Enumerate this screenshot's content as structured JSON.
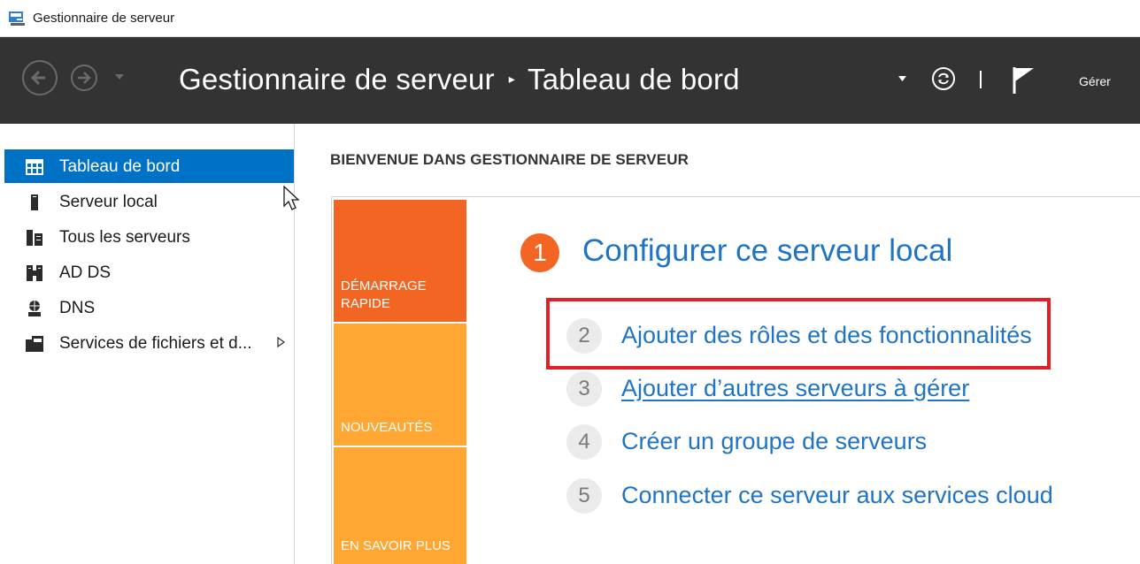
{
  "window": {
    "title": "Gestionnaire de serveur"
  },
  "header": {
    "breadcrumb_root": "Gestionnaire de serveur",
    "breadcrumb_separator": "▸",
    "breadcrumb_current": "Tableau de bord",
    "manage_label": "Gérer"
  },
  "sidebar": {
    "items": [
      {
        "label": "Tableau de bord",
        "icon": "dashboard-icon",
        "selected": true
      },
      {
        "label": "Serveur local",
        "icon": "server-icon"
      },
      {
        "label": "Tous les serveurs",
        "icon": "servers-icon"
      },
      {
        "label": "AD DS",
        "icon": "ad-ds-icon"
      },
      {
        "label": "DNS",
        "icon": "dns-icon"
      },
      {
        "label": "Services de fichiers et d...",
        "icon": "file-services-icon",
        "expandable": true
      }
    ]
  },
  "main": {
    "welcome_heading": "BIENVENUE DANS GESTIONNAIRE DE SERVEUR",
    "tiles": [
      {
        "label": "DÉMARRAGE RAPIDE",
        "color": "#f26522"
      },
      {
        "label": "NOUVEAUTÉS",
        "color": "#ffa633"
      },
      {
        "label": "EN SAVOIR PLUS",
        "color": "#ffa633"
      }
    ],
    "steps": [
      {
        "number": "1",
        "label": "Configurer ce serveur local"
      },
      {
        "number": "2",
        "label": "Ajouter des rôles et des fonctionnalités",
        "highlighted": true
      },
      {
        "number": "3",
        "label": "Ajouter d’autres serveurs à gérer"
      },
      {
        "number": "4",
        "label": "Créer un groupe de serveurs"
      },
      {
        "number": "5",
        "label": "Connecter ce serveur aux services cloud"
      }
    ]
  },
  "colors": {
    "header_bg": "#333333",
    "selected_bg": "#0072c6",
    "link": "#1f74c4",
    "accent_orange": "#f26522",
    "tile_orange": "#ffa633",
    "highlight_red": "#e31e24"
  }
}
